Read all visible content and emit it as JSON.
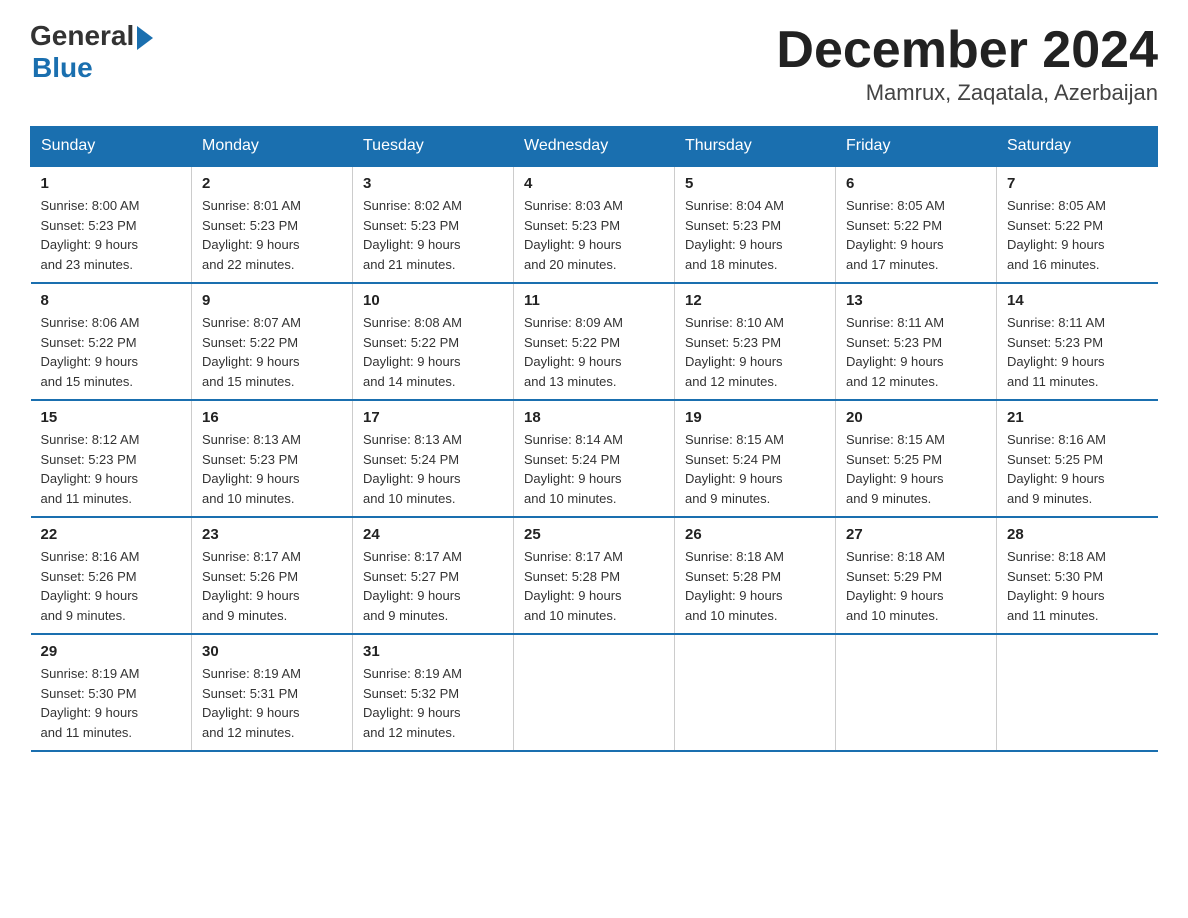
{
  "logo": {
    "general": "General",
    "blue": "Blue"
  },
  "title": "December 2024",
  "location": "Mamrux, Zaqatala, Azerbaijan",
  "days_header": [
    "Sunday",
    "Monday",
    "Tuesday",
    "Wednesday",
    "Thursday",
    "Friday",
    "Saturday"
  ],
  "weeks": [
    [
      {
        "num": "1",
        "sunrise": "8:00 AM",
        "sunset": "5:23 PM",
        "daylight": "9 hours and 23 minutes."
      },
      {
        "num": "2",
        "sunrise": "8:01 AM",
        "sunset": "5:23 PM",
        "daylight": "9 hours and 22 minutes."
      },
      {
        "num": "3",
        "sunrise": "8:02 AM",
        "sunset": "5:23 PM",
        "daylight": "9 hours and 21 minutes."
      },
      {
        "num": "4",
        "sunrise": "8:03 AM",
        "sunset": "5:23 PM",
        "daylight": "9 hours and 20 minutes."
      },
      {
        "num": "5",
        "sunrise": "8:04 AM",
        "sunset": "5:23 PM",
        "daylight": "9 hours and 18 minutes."
      },
      {
        "num": "6",
        "sunrise": "8:05 AM",
        "sunset": "5:22 PM",
        "daylight": "9 hours and 17 minutes."
      },
      {
        "num": "7",
        "sunrise": "8:05 AM",
        "sunset": "5:22 PM",
        "daylight": "9 hours and 16 minutes."
      }
    ],
    [
      {
        "num": "8",
        "sunrise": "8:06 AM",
        "sunset": "5:22 PM",
        "daylight": "9 hours and 15 minutes."
      },
      {
        "num": "9",
        "sunrise": "8:07 AM",
        "sunset": "5:22 PM",
        "daylight": "9 hours and 15 minutes."
      },
      {
        "num": "10",
        "sunrise": "8:08 AM",
        "sunset": "5:22 PM",
        "daylight": "9 hours and 14 minutes."
      },
      {
        "num": "11",
        "sunrise": "8:09 AM",
        "sunset": "5:22 PM",
        "daylight": "9 hours and 13 minutes."
      },
      {
        "num": "12",
        "sunrise": "8:10 AM",
        "sunset": "5:23 PM",
        "daylight": "9 hours and 12 minutes."
      },
      {
        "num": "13",
        "sunrise": "8:11 AM",
        "sunset": "5:23 PM",
        "daylight": "9 hours and 12 minutes."
      },
      {
        "num": "14",
        "sunrise": "8:11 AM",
        "sunset": "5:23 PM",
        "daylight": "9 hours and 11 minutes."
      }
    ],
    [
      {
        "num": "15",
        "sunrise": "8:12 AM",
        "sunset": "5:23 PM",
        "daylight": "9 hours and 11 minutes."
      },
      {
        "num": "16",
        "sunrise": "8:13 AM",
        "sunset": "5:23 PM",
        "daylight": "9 hours and 10 minutes."
      },
      {
        "num": "17",
        "sunrise": "8:13 AM",
        "sunset": "5:24 PM",
        "daylight": "9 hours and 10 minutes."
      },
      {
        "num": "18",
        "sunrise": "8:14 AM",
        "sunset": "5:24 PM",
        "daylight": "9 hours and 10 minutes."
      },
      {
        "num": "19",
        "sunrise": "8:15 AM",
        "sunset": "5:24 PM",
        "daylight": "9 hours and 9 minutes."
      },
      {
        "num": "20",
        "sunrise": "8:15 AM",
        "sunset": "5:25 PM",
        "daylight": "9 hours and 9 minutes."
      },
      {
        "num": "21",
        "sunrise": "8:16 AM",
        "sunset": "5:25 PM",
        "daylight": "9 hours and 9 minutes."
      }
    ],
    [
      {
        "num": "22",
        "sunrise": "8:16 AM",
        "sunset": "5:26 PM",
        "daylight": "9 hours and 9 minutes."
      },
      {
        "num": "23",
        "sunrise": "8:17 AM",
        "sunset": "5:26 PM",
        "daylight": "9 hours and 9 minutes."
      },
      {
        "num": "24",
        "sunrise": "8:17 AM",
        "sunset": "5:27 PM",
        "daylight": "9 hours and 9 minutes."
      },
      {
        "num": "25",
        "sunrise": "8:17 AM",
        "sunset": "5:28 PM",
        "daylight": "9 hours and 10 minutes."
      },
      {
        "num": "26",
        "sunrise": "8:18 AM",
        "sunset": "5:28 PM",
        "daylight": "9 hours and 10 minutes."
      },
      {
        "num": "27",
        "sunrise": "8:18 AM",
        "sunset": "5:29 PM",
        "daylight": "9 hours and 10 minutes."
      },
      {
        "num": "28",
        "sunrise": "8:18 AM",
        "sunset": "5:30 PM",
        "daylight": "9 hours and 11 minutes."
      }
    ],
    [
      {
        "num": "29",
        "sunrise": "8:19 AM",
        "sunset": "5:30 PM",
        "daylight": "9 hours and 11 minutes."
      },
      {
        "num": "30",
        "sunrise": "8:19 AM",
        "sunset": "5:31 PM",
        "daylight": "9 hours and 12 minutes."
      },
      {
        "num": "31",
        "sunrise": "8:19 AM",
        "sunset": "5:32 PM",
        "daylight": "9 hours and 12 minutes."
      },
      null,
      null,
      null,
      null
    ]
  ],
  "labels": {
    "sunrise": "Sunrise:",
    "sunset": "Sunset:",
    "daylight": "Daylight:"
  }
}
